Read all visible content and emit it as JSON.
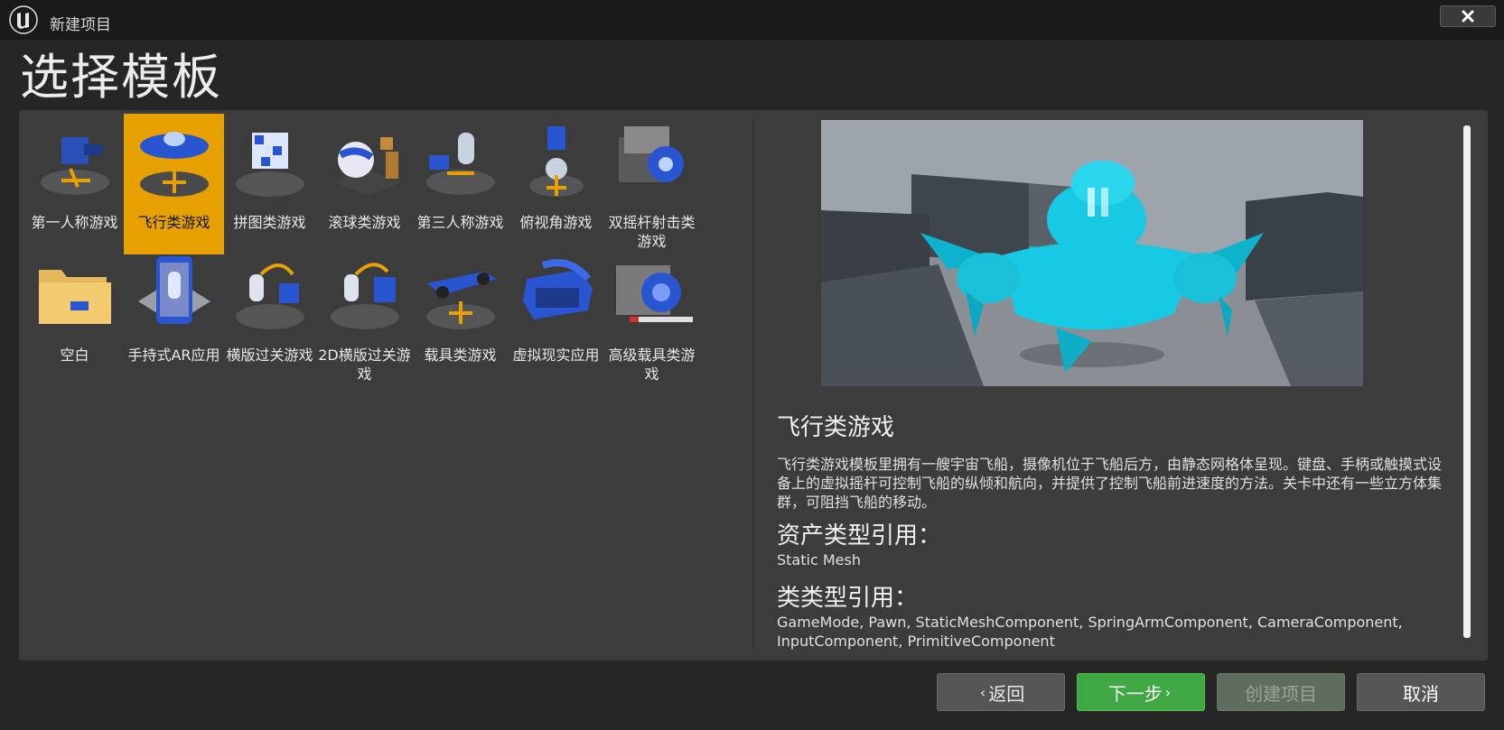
{
  "window": {
    "title": "新建项目"
  },
  "page": {
    "title": "选择模板"
  },
  "templates": [
    {
      "label": "第一人称游戏",
      "icon": "first-person-icon"
    },
    {
      "label": "飞行类游戏",
      "icon": "flying-icon",
      "selected": true
    },
    {
      "label": "拼图类游戏",
      "icon": "puzzle-icon"
    },
    {
      "label": "滚球类游戏",
      "icon": "rolling-icon"
    },
    {
      "label": "第三人称游戏",
      "icon": "third-person-icon"
    },
    {
      "label": "俯视角游戏",
      "icon": "top-down-icon"
    },
    {
      "label": "双摇杆射击类游戏",
      "icon": "twin-stick-icon"
    },
    {
      "label": "空白",
      "icon": "blank-folder-icon"
    },
    {
      "label": "手持式AR应用",
      "icon": "handheld-ar-icon"
    },
    {
      "label": "横版过关游戏",
      "icon": "side-scroller-icon"
    },
    {
      "label": "2D横版过关游戏",
      "icon": "2d-side-scroller-icon"
    },
    {
      "label": "载具类游戏",
      "icon": "vehicle-icon"
    },
    {
      "label": "虚拟现实应用",
      "icon": "vr-headset-icon"
    },
    {
      "label": "高级载具类游戏",
      "icon": "advanced-vehicle-icon"
    }
  ],
  "details": {
    "title": "飞行类游戏",
    "description": "飞行类游戏模板里拥有一艘宇宙飞船，摄像机位于飞船后方，由静态网格体呈现。键盘、手柄或触摸式设备上的虚拟摇杆可控制飞船的纵倾和航向，并提供了控制飞船前进速度的方法。关卡中还有一些立方体集群，可阻挡飞船的移动。",
    "asset_heading": "资产类型引用：",
    "asset_value": "Static Mesh",
    "class_heading": "类类型引用：",
    "class_value": "GameMode, Pawn, StaticMeshComponent, SpringArmComponent, CameraComponent, InputComponent, PrimitiveComponent"
  },
  "buttons": {
    "back": "返回",
    "next": "下一步",
    "create": "创建项目",
    "cancel": "取消"
  },
  "colors": {
    "selected": "#e6a000",
    "next_button": "#40a843",
    "ship": "#00c8e0"
  }
}
